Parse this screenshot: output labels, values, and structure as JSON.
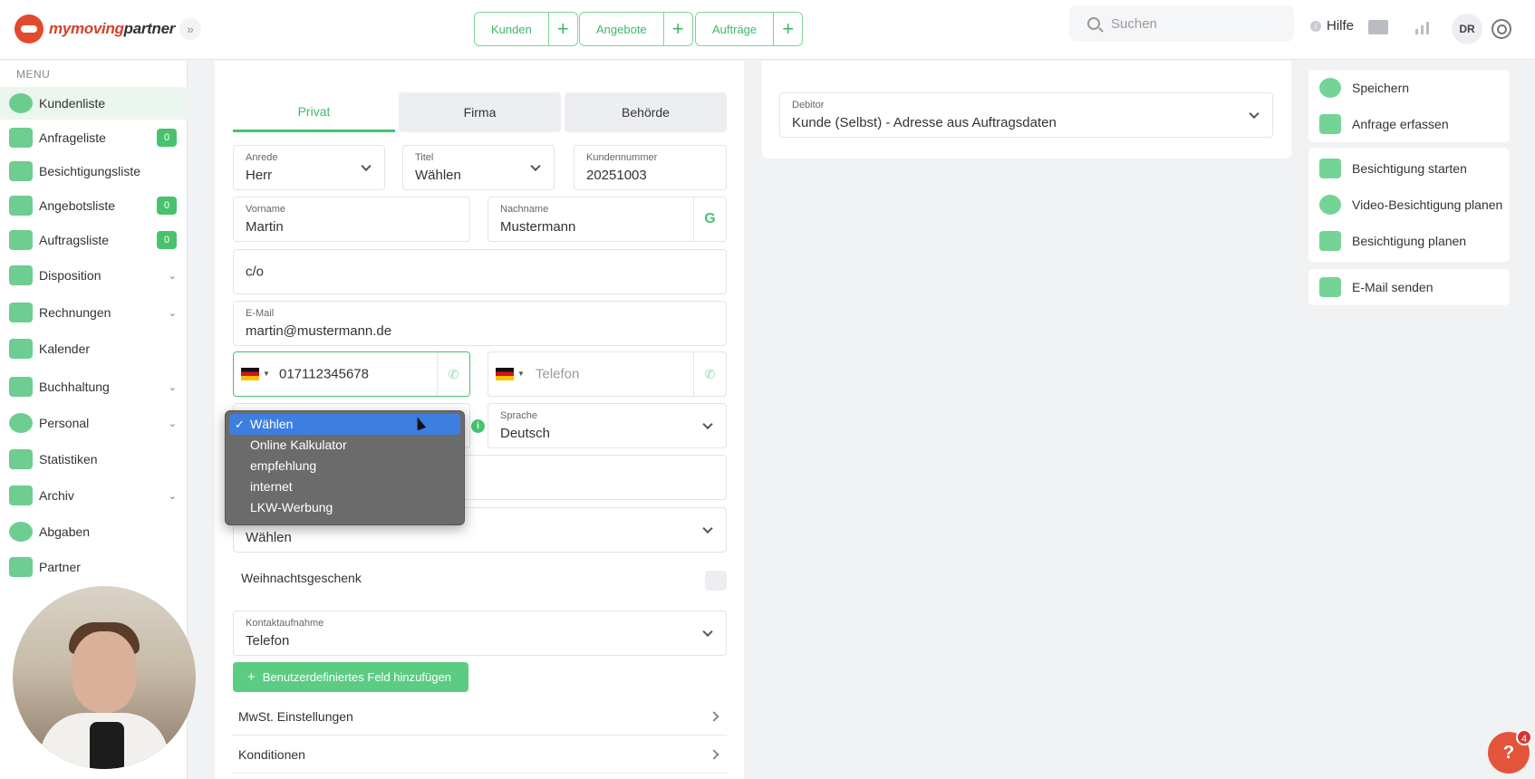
{
  "brand": {
    "name_part1": "mymoving",
    "name_part2": "partner"
  },
  "topnav": [
    {
      "label": "Kunden"
    },
    {
      "label": "Angebote"
    },
    {
      "label": "Aufträge"
    }
  ],
  "search": {
    "placeholder": "Suchen"
  },
  "header": {
    "help_label": "Hilfe",
    "avatar_initials": "DR"
  },
  "sidebar": {
    "title": "MENU",
    "items": [
      {
        "label": "Kundenliste"
      },
      {
        "label": "Anfrageliste",
        "badge": "0"
      },
      {
        "label": "Besichtigungsliste"
      },
      {
        "label": "Angebotsliste",
        "badge": "0"
      },
      {
        "label": "Auftragsliste",
        "badge": "0"
      },
      {
        "label": "Disposition"
      },
      {
        "label": "Rechnungen"
      },
      {
        "label": "Kalender"
      },
      {
        "label": "Buchhaltung"
      },
      {
        "label": "Personal"
      },
      {
        "label": "Statistiken"
      },
      {
        "label": "Archiv"
      },
      {
        "label": "Abgaben"
      },
      {
        "label": "Partner"
      }
    ]
  },
  "form": {
    "tabs": [
      "Privat",
      "Firma",
      "Behörde"
    ],
    "anrede": {
      "label": "Anrede",
      "value": "Herr"
    },
    "titel": {
      "label": "Titel",
      "value": "Wählen"
    },
    "kundennummer": {
      "label": "Kundennummer",
      "value": "20251003"
    },
    "vorname": {
      "label": "Vorname",
      "value": "Martin"
    },
    "nachname": {
      "label": "Nachname",
      "value": "Mustermann"
    },
    "gender_button": "G",
    "co": {
      "value": "c/o"
    },
    "email": {
      "label": "E-Mail",
      "value": "martin@mustermann.de"
    },
    "mobile": {
      "value": "017112345678"
    },
    "telefon": {
      "placeholder": "Telefon"
    },
    "sprache": {
      "label": "Sprache",
      "value": "Deutsch"
    },
    "source_dropdown": {
      "options": [
        "Wählen",
        "Online Kalkulator",
        "empfehlung",
        "internet",
        "LKW-Werbung"
      ],
      "selected": "Wählen",
      "check": "✓"
    },
    "select_below": {
      "value": "Wählen"
    },
    "weihnachtsgeschenk": "Weihnachtsgeschenk",
    "kontaktaufnahme": {
      "label": "Kontaktaufnahme",
      "value": "Telefon"
    },
    "add_field_button": "Benutzerdefiniertes Feld hinzufügen",
    "sections": [
      "MwSt. Einstellungen",
      "Konditionen"
    ]
  },
  "debitor": {
    "label": "Debitor",
    "value": "Kunde (Selbst) - Adresse aus Auftragsdaten"
  },
  "actions": {
    "group1": [
      "Speichern",
      "Anfrage erfassen"
    ],
    "group2": [
      "Besichtigung starten",
      "Video-Besichtigung planen",
      "Besichtigung planen"
    ],
    "group3": [
      "E-Mail senden"
    ]
  },
  "help_bubble": {
    "label": "?",
    "count": "4"
  },
  "colors": {
    "accent": "#49c26e",
    "brand": "#d2412a",
    "selected": "#3d7fe0"
  }
}
